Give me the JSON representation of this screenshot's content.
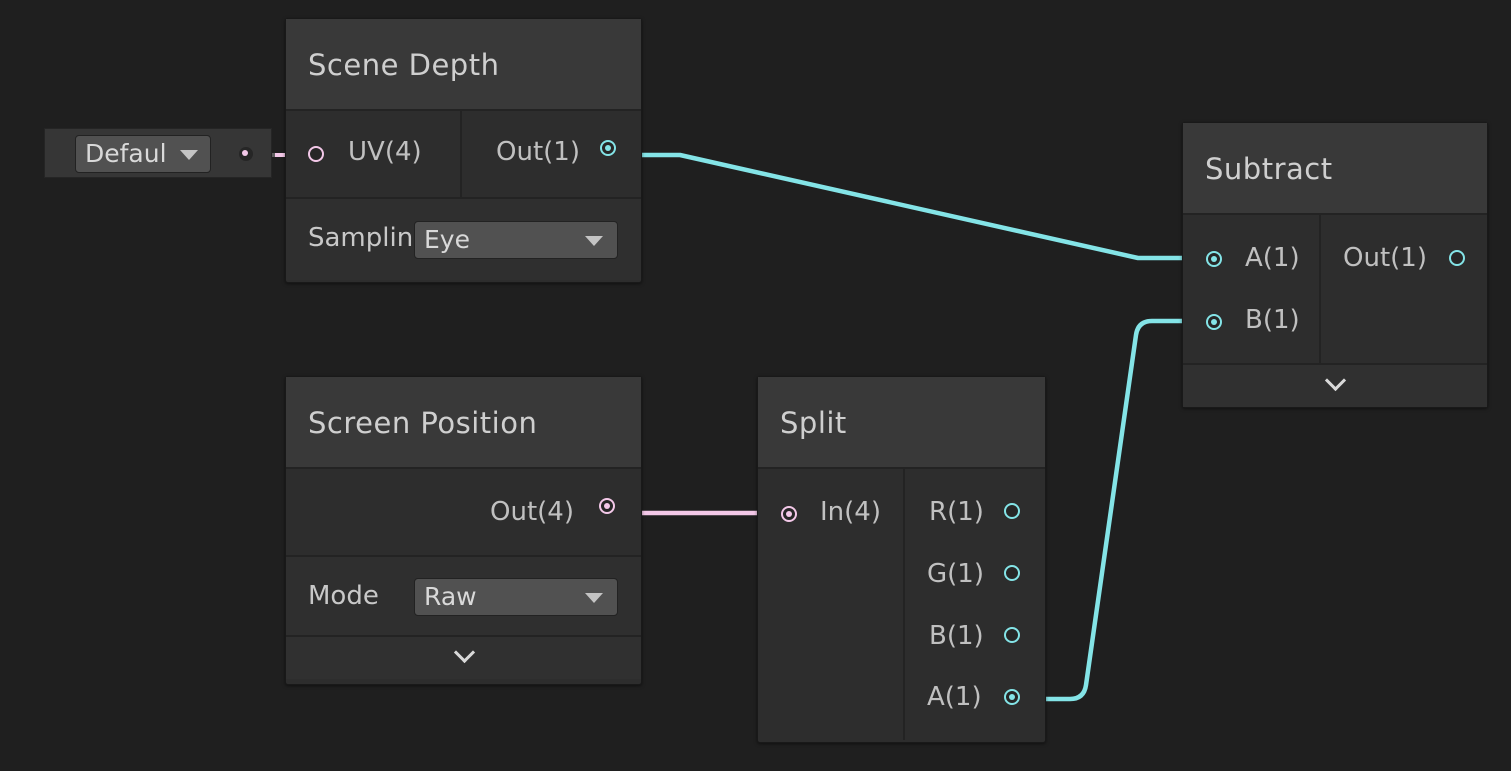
{
  "colors": {
    "canvas": "#1f1f1f",
    "vector1_wire": "#84e4e7",
    "vector4_wire": "#f3c8e8",
    "node_body": "#2d2d2d",
    "node_header": "#393939"
  },
  "inline_uv_input": {
    "value": "Defaul",
    "icon": "chevron-down-icon"
  },
  "nodes": {
    "scene_depth": {
      "title": "Scene Depth",
      "input_port": "UV(4)",
      "output_port": "Out(1)",
      "setting_label": "Samplin",
      "setting_value": "Eye"
    },
    "screen_position": {
      "title": "Screen Position",
      "output_port": "Out(4)",
      "setting_label": "Mode",
      "setting_value": "Raw"
    },
    "split": {
      "title": "Split",
      "input_port": "In(4)",
      "output_ports": [
        "R(1)",
        "G(1)",
        "B(1)",
        "A(1)"
      ]
    },
    "subtract": {
      "title": "Subtract",
      "input_ports": [
        "A(1)",
        "B(1)"
      ],
      "output_port": "Out(1)"
    }
  }
}
